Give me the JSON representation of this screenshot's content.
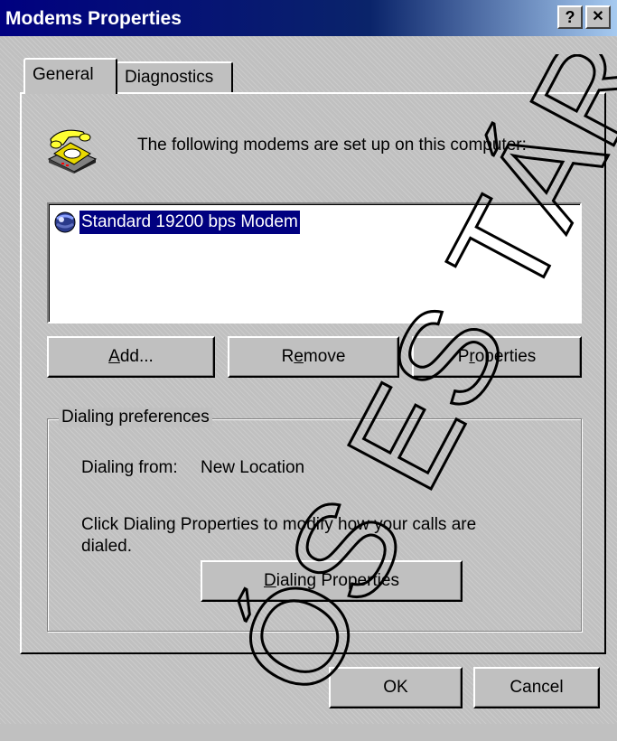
{
  "window": {
    "title": "Modems Properties",
    "help_label": "?",
    "close_label": "✕"
  },
  "tabs": [
    {
      "label": "General",
      "active": true
    },
    {
      "label": "Diagnostics",
      "active": false
    }
  ],
  "intro_text": "The following modems are set up on this computer:",
  "modems": [
    {
      "name": "Standard 19200 bps Modem",
      "selected": true
    }
  ],
  "buttons": {
    "add": {
      "pre": "",
      "u": "A",
      "post": "dd..."
    },
    "remove": {
      "pre": "R",
      "u": "e",
      "post": "move"
    },
    "properties": {
      "pre": "P",
      "u": "r",
      "post": "operties"
    }
  },
  "dialing": {
    "group_label": "Dialing preferences",
    "from_label": "Dialing from:",
    "from_value": "New Location",
    "help_text_line1": "Click Dialing Properties to modify how your calls are",
    "help_text_line2": "dialed.",
    "button": {
      "pre": "",
      "u": "D",
      "post": "ialing Properties"
    }
  },
  "footer": {
    "ok_label": "OK",
    "cancel_label": "Cancel"
  },
  "watermark_text": "ÓS ES TÁRSA",
  "colors": {
    "titlebar": "#000080",
    "selection": "#000080",
    "face": "#c0c0c0"
  }
}
